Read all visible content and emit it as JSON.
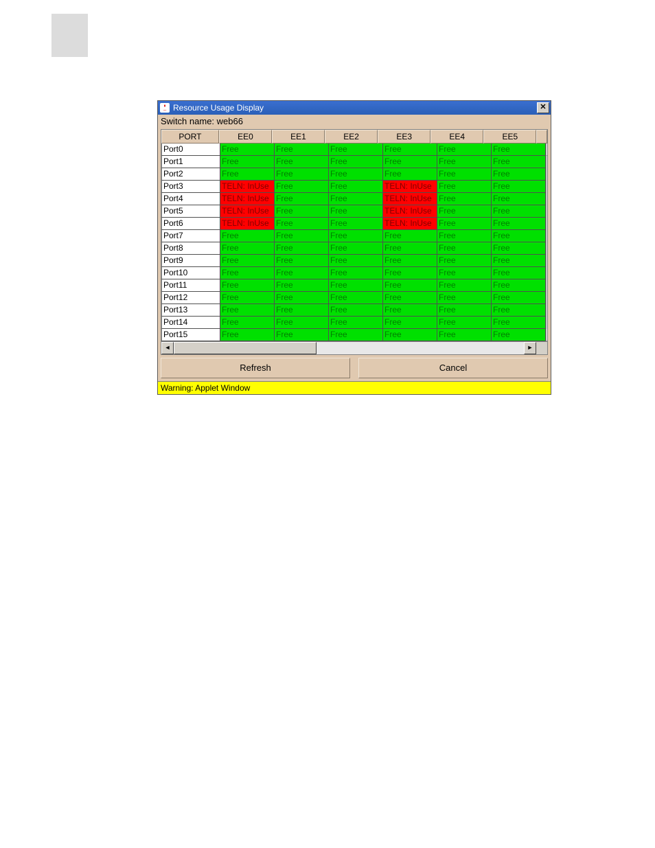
{
  "window": {
    "title": "Resource Usage Display",
    "switch_label": "Switch name:",
    "switch_name": "web66",
    "close_glyph": "✕"
  },
  "columns": [
    "PORT",
    "EE0",
    "EE1",
    "EE2",
    "EE3",
    "EE4",
    "EE5"
  ],
  "rows": [
    {
      "port": "Port0",
      "cells": [
        {
          "t": "Free",
          "s": "free"
        },
        {
          "t": "Free",
          "s": "free"
        },
        {
          "t": "Free",
          "s": "free"
        },
        {
          "t": "Free",
          "s": "free"
        },
        {
          "t": "Free",
          "s": "free"
        },
        {
          "t": "Free",
          "s": "free"
        }
      ]
    },
    {
      "port": "Port1",
      "cells": [
        {
          "t": "Free",
          "s": "free"
        },
        {
          "t": "Free",
          "s": "free"
        },
        {
          "t": "Free",
          "s": "free"
        },
        {
          "t": "Free",
          "s": "free"
        },
        {
          "t": "Free",
          "s": "free"
        },
        {
          "t": "Free",
          "s": "free"
        }
      ]
    },
    {
      "port": "Port2",
      "cells": [
        {
          "t": "Free",
          "s": "free"
        },
        {
          "t": "Free",
          "s": "free"
        },
        {
          "t": "Free",
          "s": "free"
        },
        {
          "t": "Free",
          "s": "free"
        },
        {
          "t": "Free",
          "s": "free"
        },
        {
          "t": "Free",
          "s": "free"
        }
      ]
    },
    {
      "port": "Port3",
      "cells": [
        {
          "t": "TELN: InUse",
          "s": "inuse"
        },
        {
          "t": "Free",
          "s": "free"
        },
        {
          "t": "Free",
          "s": "free"
        },
        {
          "t": "TELN: InUse",
          "s": "inuse"
        },
        {
          "t": "Free",
          "s": "free"
        },
        {
          "t": "Free",
          "s": "free"
        }
      ]
    },
    {
      "port": "Port4",
      "cells": [
        {
          "t": "TELN: InUse",
          "s": "inuse"
        },
        {
          "t": "Free",
          "s": "free"
        },
        {
          "t": "Free",
          "s": "free"
        },
        {
          "t": "TELN: InUse",
          "s": "inuse"
        },
        {
          "t": "Free",
          "s": "free"
        },
        {
          "t": "Free",
          "s": "free"
        }
      ]
    },
    {
      "port": "Port5",
      "cells": [
        {
          "t": "TELN: InUse",
          "s": "inuse"
        },
        {
          "t": "Free",
          "s": "free"
        },
        {
          "t": "Free",
          "s": "free"
        },
        {
          "t": "TELN: InUse",
          "s": "inuse"
        },
        {
          "t": "Free",
          "s": "free"
        },
        {
          "t": "Free",
          "s": "free"
        }
      ]
    },
    {
      "port": "Port6",
      "cells": [
        {
          "t": "TELN: InUse",
          "s": "inuse"
        },
        {
          "t": "Free",
          "s": "free"
        },
        {
          "t": "Free",
          "s": "free"
        },
        {
          "t": "TELN: InUse",
          "s": "inuse"
        },
        {
          "t": "Free",
          "s": "free"
        },
        {
          "t": "Free",
          "s": "free"
        }
      ]
    },
    {
      "port": "Port7",
      "cells": [
        {
          "t": "Free",
          "s": "free"
        },
        {
          "t": "Free",
          "s": "free"
        },
        {
          "t": "Free",
          "s": "free"
        },
        {
          "t": "Free",
          "s": "free"
        },
        {
          "t": "Free",
          "s": "free"
        },
        {
          "t": "Free",
          "s": "free"
        }
      ]
    },
    {
      "port": "Port8",
      "cells": [
        {
          "t": "Free",
          "s": "free"
        },
        {
          "t": "Free",
          "s": "free"
        },
        {
          "t": "Free",
          "s": "free"
        },
        {
          "t": "Free",
          "s": "free"
        },
        {
          "t": "Free",
          "s": "free"
        },
        {
          "t": "Free",
          "s": "free"
        }
      ]
    },
    {
      "port": "Port9",
      "cells": [
        {
          "t": "Free",
          "s": "free"
        },
        {
          "t": "Free",
          "s": "free"
        },
        {
          "t": "Free",
          "s": "free"
        },
        {
          "t": "Free",
          "s": "free"
        },
        {
          "t": "Free",
          "s": "free"
        },
        {
          "t": "Free",
          "s": "free"
        }
      ]
    },
    {
      "port": "Port10",
      "cells": [
        {
          "t": "Free",
          "s": "free"
        },
        {
          "t": "Free",
          "s": "free"
        },
        {
          "t": "Free",
          "s": "free"
        },
        {
          "t": "Free",
          "s": "free"
        },
        {
          "t": "Free",
          "s": "free"
        },
        {
          "t": "Free",
          "s": "free"
        }
      ]
    },
    {
      "port": "Port11",
      "cells": [
        {
          "t": "Free",
          "s": "free"
        },
        {
          "t": "Free",
          "s": "free"
        },
        {
          "t": "Free",
          "s": "free"
        },
        {
          "t": "Free",
          "s": "free"
        },
        {
          "t": "Free",
          "s": "free"
        },
        {
          "t": "Free",
          "s": "free"
        }
      ]
    },
    {
      "port": "Port12",
      "cells": [
        {
          "t": "Free",
          "s": "free"
        },
        {
          "t": "Free",
          "s": "free"
        },
        {
          "t": "Free",
          "s": "free"
        },
        {
          "t": "Free",
          "s": "free"
        },
        {
          "t": "Free",
          "s": "free"
        },
        {
          "t": "Free",
          "s": "free"
        }
      ]
    },
    {
      "port": "Port13",
      "cells": [
        {
          "t": "Free",
          "s": "free"
        },
        {
          "t": "Free",
          "s": "free"
        },
        {
          "t": "Free",
          "s": "free"
        },
        {
          "t": "Free",
          "s": "free"
        },
        {
          "t": "Free",
          "s": "free"
        },
        {
          "t": "Free",
          "s": "free"
        }
      ]
    },
    {
      "port": "Port14",
      "cells": [
        {
          "t": "Free",
          "s": "free"
        },
        {
          "t": "Free",
          "s": "free"
        },
        {
          "t": "Free",
          "s": "free"
        },
        {
          "t": "Free",
          "s": "free"
        },
        {
          "t": "Free",
          "s": "free"
        },
        {
          "t": "Free",
          "s": "free"
        }
      ]
    },
    {
      "port": "Port15",
      "cells": [
        {
          "t": "Free",
          "s": "free"
        },
        {
          "t": "Free",
          "s": "free"
        },
        {
          "t": "Free",
          "s": "free"
        },
        {
          "t": "Free",
          "s": "free"
        },
        {
          "t": "Free",
          "s": "free"
        },
        {
          "t": "Free",
          "s": "free"
        }
      ]
    }
  ],
  "buttons": {
    "refresh": "Refresh",
    "cancel": "Cancel"
  },
  "scroll": {
    "up": "▲",
    "down": "▼",
    "left": "◄",
    "right": "►"
  },
  "warning": "Warning: Applet Window"
}
